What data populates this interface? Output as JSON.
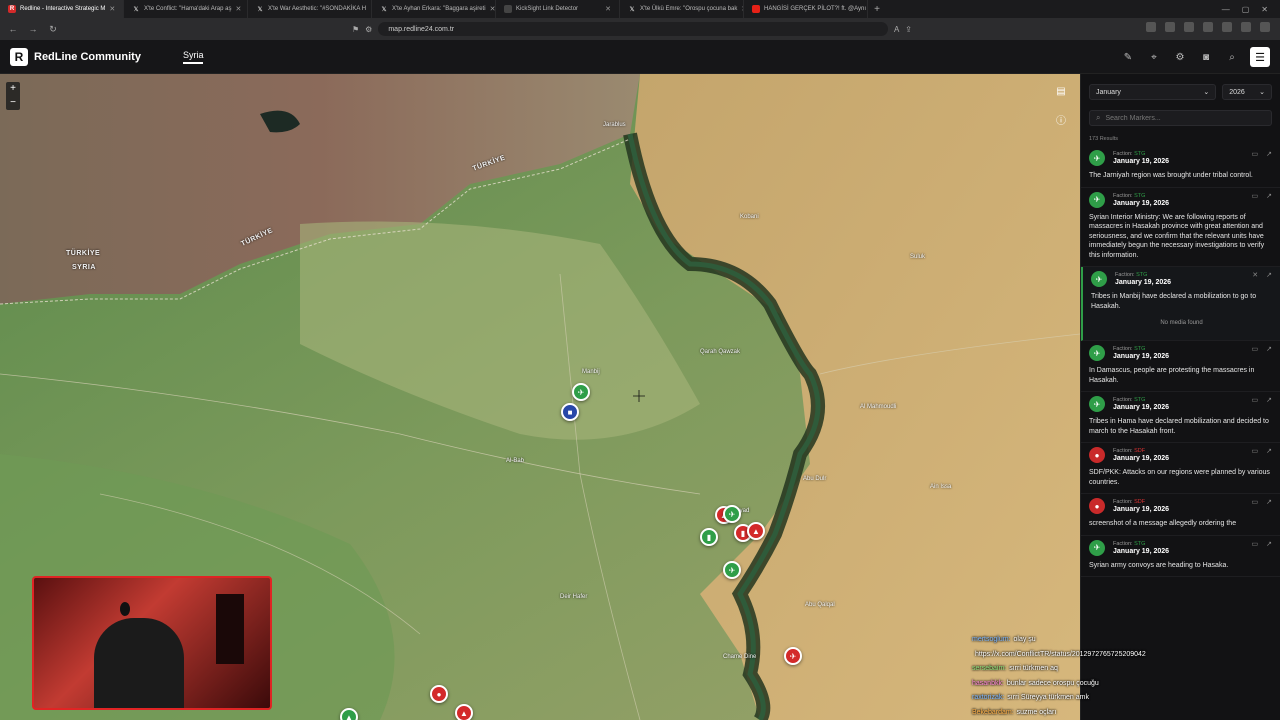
{
  "browser": {
    "tabs": [
      {
        "label": "Redline - Interactive Strategic M",
        "active": true,
        "icon": "redline-icon"
      },
      {
        "label": "X'te Conflict: \"Hama'daki Arap aş",
        "icon": "x-icon"
      },
      {
        "label": "X'te War Aesthetic: \"#SONDAKİKA H",
        "icon": "x-icon"
      },
      {
        "label": "X'te Ayhan Erkara: \"Baggara aşireti",
        "icon": "x-icon"
      },
      {
        "label": "KickSight Link Detector",
        "icon": "page-icon"
      },
      {
        "label": "X'te Ülkü Emre: \"Orospu çocuna bak",
        "icon": "x-icon"
      },
      {
        "label": "HANGİSİ GERÇEK PİLOT?! ft. @Aynı",
        "icon": "youtube-icon"
      }
    ],
    "url": "map.redline24.com.tr"
  },
  "app": {
    "logo_letter": "R",
    "brand": "RedLine Community",
    "region_tab": "Syria"
  },
  "filters": {
    "month": "January",
    "year": "2026",
    "search_placeholder": "Search Markers...",
    "results_count": "173 Results"
  },
  "map": {
    "labels": {
      "turkiye_1": "TÜRKİYE",
      "turkiye_2": "TÜRKİYE",
      "turkiye_syria": "TÜRKİYE",
      "syria": "SYRIA",
      "abu_duhur": "Abu Dulr",
      "tell_abyad": "Tell Abyad",
      "jarablus": "Jarablus",
      "manbij": "Manbij",
      "al_bab": "Al-Bab",
      "chame_dine": "Chame Dine",
      "abu_qalqal": "Abu Qalqal",
      "qarah_qawzak": "Qarah Qawzak",
      "ain_issa": "Ain Issa",
      "suluk": "Suluk",
      "kobani": "Kobani",
      "deir_hafer": "Deir Hafer",
      "al_mahmoudli": "Al Mahmoudli"
    }
  },
  "entries": [
    {
      "faction_label": "Faction:",
      "faction": "STG",
      "faction_color": "#2f9e48",
      "date": "January 19, 2026",
      "text": "The Jarniyah region was brought under tribal control."
    },
    {
      "faction_label": "Faction:",
      "faction": "STG",
      "faction_color": "#2f9e48",
      "date": "January 19, 2026",
      "text": "Syrian Interior Ministry: We are following reports of massacres in Hasakah province with great attention and seriousness, and we confirm that the relevant units have immediately begun the necessary investigations to verify this information."
    },
    {
      "faction_label": "Faction:",
      "faction": "STG",
      "faction_color": "#2f9e48",
      "date": "January 19, 2026",
      "text": "Tribes in Manbij have declared a mobilization to go to Hasakah.",
      "media": "No media found",
      "selected": true
    },
    {
      "faction_label": "Faction:",
      "faction": "STG",
      "faction_color": "#2f9e48",
      "date": "January 19, 2026",
      "text": "In Damascus, people are protesting the massacres in Hasakah."
    },
    {
      "faction_label": "Faction:",
      "faction": "STG",
      "faction_color": "#2f9e48",
      "date": "January 19, 2026",
      "text": "Tribes in Hama have declared mobilization and decided to march to the Hasakah front."
    },
    {
      "faction_label": "Faction:",
      "faction": "SDF",
      "faction_color": "#c92a2a",
      "date": "January 19, 2026",
      "text": "SDF/PKK: Attacks on our regions were planned by various countries."
    },
    {
      "faction_label": "Faction:",
      "faction": "SDF",
      "faction_color": "#c92a2a",
      "date": "January 19, 2026",
      "text": "screenshot of a message allegedly ordering the"
    },
    {
      "faction_label": "Faction:",
      "faction": "STG",
      "faction_color": "#2f9e48",
      "date": "January 19, 2026",
      "text": "Syrian army convoys are heading to Hasaka."
    }
  ],
  "chat": [
    {
      "user": "mertsoglum:",
      "text": "olay şu"
    },
    {
      "user": "",
      "text": "https://x.com/ConflictTR/status/2012972765725209042"
    },
    {
      "user": "sersebaim:",
      "text": "sırri türkmen aq"
    },
    {
      "user": "hasanbkk:",
      "text": "bunlar sadece orospu çocuğu"
    },
    {
      "user": "raxtorizak:",
      "text": "sırri Süreyya türkmen amk"
    },
    {
      "user": "Bekebardam:",
      "text": "suzme oçları"
    }
  ],
  "colors": {
    "stg": "#2f9e48",
    "sdf": "#c92a2a",
    "accent": "#ffffff"
  }
}
